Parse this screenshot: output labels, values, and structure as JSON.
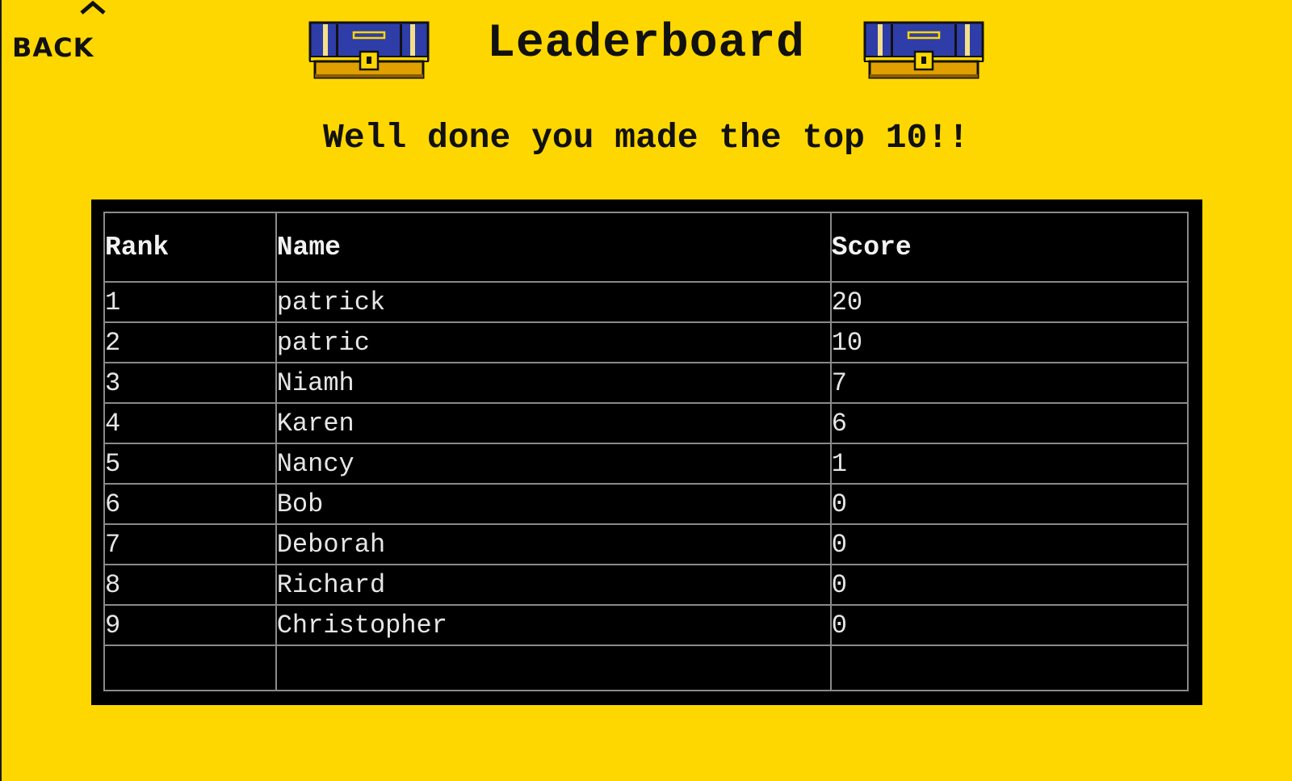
{
  "nav": {
    "back_label": "BACK",
    "back_icon": "chevron-up-icon"
  },
  "header": {
    "title": "Leaderboard",
    "subtitle": "Well done you made the top 10!!",
    "decoration_icon": "treasure-chest-icon"
  },
  "table": {
    "columns": {
      "rank": "Rank",
      "name": "Name",
      "score": "Score"
    },
    "rows": [
      {
        "rank": "1",
        "name": "patrick",
        "score": "20"
      },
      {
        "rank": "2",
        "name": "patric",
        "score": "10"
      },
      {
        "rank": "3",
        "name": "Niamh",
        "score": "7"
      },
      {
        "rank": "4",
        "name": "Karen",
        "score": "6"
      },
      {
        "rank": "5",
        "name": "Nancy",
        "score": "1"
      },
      {
        "rank": "6",
        "name": "Bob",
        "score": "0"
      },
      {
        "rank": "7",
        "name": "Deborah",
        "score": "0"
      },
      {
        "rank": "8",
        "name": "Richard",
        "score": "0"
      },
      {
        "rank": "9",
        "name": "Christopher",
        "score": "0"
      },
      {
        "rank": "",
        "name": "",
        "score": ""
      }
    ]
  },
  "colors": {
    "background": "#FFD700",
    "board": "#000000",
    "chest_blue": "#2E3DA8",
    "chest_gold": "#E0A000"
  }
}
